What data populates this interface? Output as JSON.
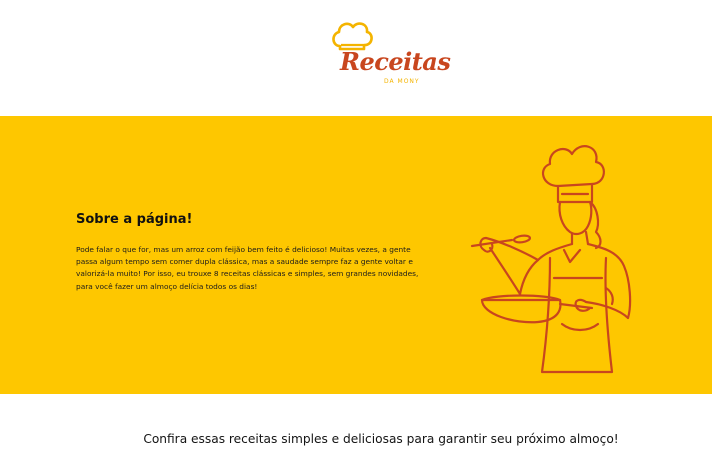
{
  "logo": {
    "title": "Receitas",
    "subtitle": "DA MONY",
    "icon": "chef-hat-icon",
    "colors": {
      "primary": "#c8461e",
      "accent": "#f4b400"
    }
  },
  "about": {
    "heading": "Sobre a página!",
    "body": "Pode falar o que for, mas um arroz com feijão bem feito é delicioso! Muitas vezes, a gente passa algum tempo sem comer dupla clássica, mas a saudade sempre faz a gente voltar e valorizá-la muito! Por isso, eu trouxe 8 receitas clássicas e simples, sem grandes novidades, para você fazer um almoço delícia todos os dias!",
    "background": "#fec700",
    "illustration": "chef-cooking-illustration",
    "line_color": "#c8461e"
  },
  "recipes_intro": {
    "text": "Confira essas receitas simples e deliciosas para garantir seu próximo almoço!"
  }
}
